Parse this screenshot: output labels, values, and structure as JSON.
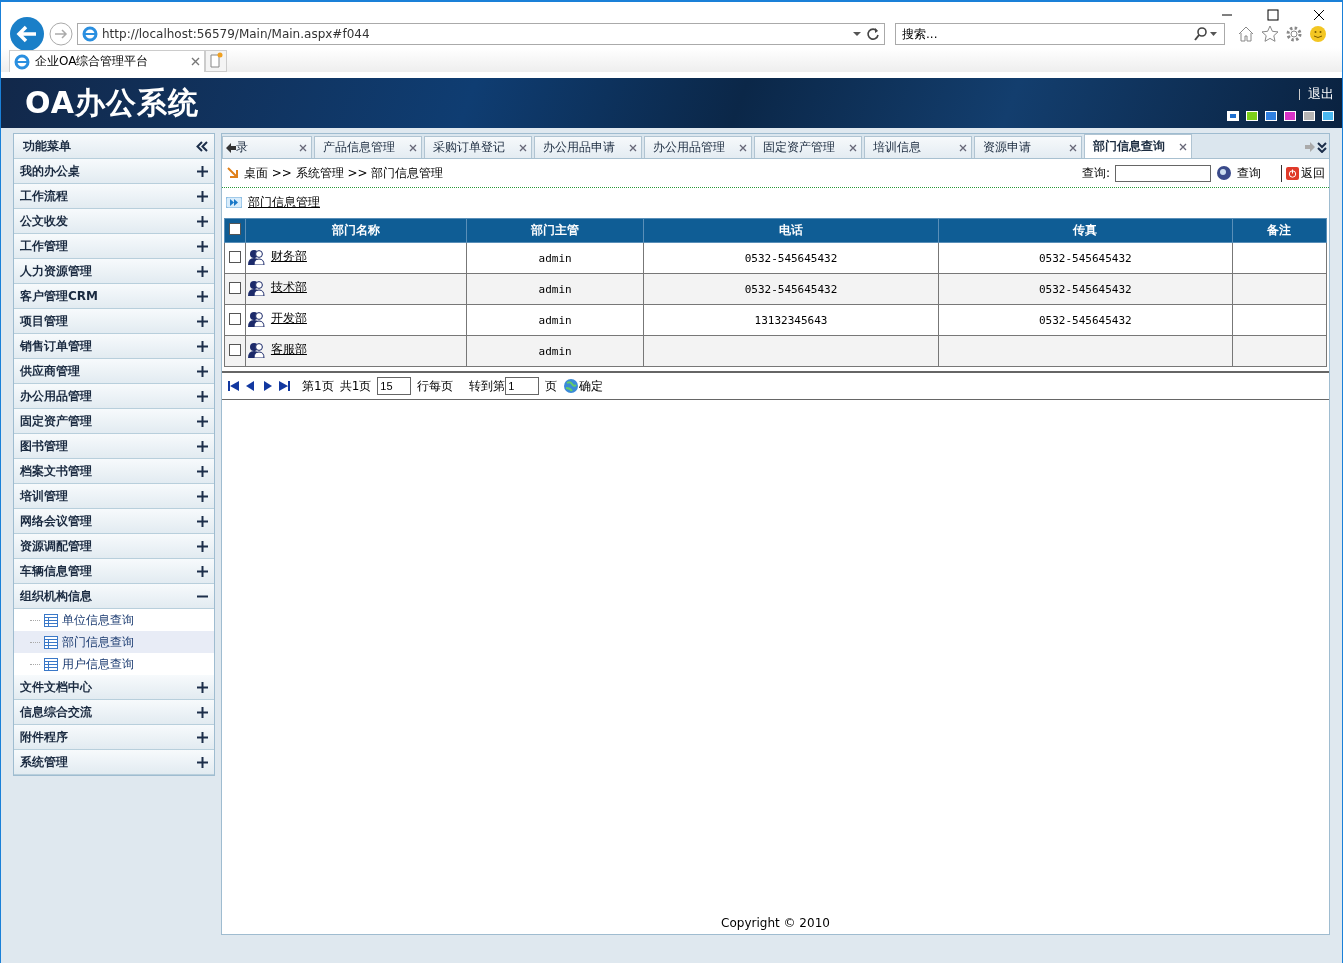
{
  "browser": {
    "address": "http://localhost:56579/Main/Main.aspx#f044",
    "search_placeholder": "搜索...",
    "tab_title": "企业OA综合管理平台"
  },
  "header": {
    "logo": "OA办公系统",
    "logout": "退出",
    "skins": [
      {
        "color": "#1e6fd0",
        "selected": true
      },
      {
        "color": "#7ccf1a",
        "selected": false
      },
      {
        "color": "#2f7fe0",
        "selected": false
      },
      {
        "color": "#d933c8",
        "selected": false
      },
      {
        "color": "#b4b4b4",
        "selected": false
      },
      {
        "color": "#49b8f0",
        "selected": false
      }
    ]
  },
  "sidebar": {
    "title": "功能菜单",
    "items": [
      {
        "label": "我的办公桌",
        "expanded": false
      },
      {
        "label": "工作流程",
        "expanded": false
      },
      {
        "label": "公文收发",
        "expanded": false
      },
      {
        "label": "工作管理",
        "expanded": false
      },
      {
        "label": "人力资源管理",
        "expanded": false
      },
      {
        "label": "客户管理CRM",
        "expanded": false
      },
      {
        "label": "项目管理",
        "expanded": false
      },
      {
        "label": "销售订单管理",
        "expanded": false
      },
      {
        "label": "供应商管理",
        "expanded": false
      },
      {
        "label": "办公用品管理",
        "expanded": false
      },
      {
        "label": "固定资产管理",
        "expanded": false
      },
      {
        "label": "图书管理",
        "expanded": false
      },
      {
        "label": "档案文书管理",
        "expanded": false
      },
      {
        "label": "培训管理",
        "expanded": false
      },
      {
        "label": "网络会议管理",
        "expanded": false
      },
      {
        "label": "资源调配管理",
        "expanded": false
      },
      {
        "label": "车辆信息管理",
        "expanded": false
      },
      {
        "label": "组织机构信息",
        "expanded": true,
        "children": [
          {
            "label": "单位信息查询",
            "selected": false
          },
          {
            "label": "部门信息查询",
            "selected": true
          },
          {
            "label": "用户信息查询",
            "selected": false
          }
        ]
      },
      {
        "label": "文件文档中心",
        "expanded": false
      },
      {
        "label": "信息综合交流",
        "expanded": false
      },
      {
        "label": "附件程序",
        "expanded": false
      },
      {
        "label": "系统管理",
        "expanded": false
      }
    ]
  },
  "tabs": [
    {
      "label": "录",
      "selected": false
    },
    {
      "label": "产品信息管理",
      "selected": false
    },
    {
      "label": "采购订单登记",
      "selected": false
    },
    {
      "label": "办公用品申请",
      "selected": false
    },
    {
      "label": "办公用品管理",
      "selected": false
    },
    {
      "label": "固定资产管理",
      "selected": false
    },
    {
      "label": "培训信息",
      "selected": false
    },
    {
      "label": "资源申请",
      "selected": false
    },
    {
      "label": "部门信息查询",
      "selected": true
    }
  ],
  "breadcrumb": "桌面 >> 系统管理 >> 部门信息管理",
  "query": {
    "label": "查询:",
    "button": "查询",
    "back": "返回"
  },
  "section_title": "部门信息管理",
  "table": {
    "columns": [
      "部门名称",
      "部门主管",
      "电话",
      "传真",
      "备注"
    ],
    "header_checked": false,
    "rows": [
      {
        "checked": false,
        "cells": [
          "财务部",
          "admin",
          "0532-545645432",
          "0532-545645432"
        ]
      },
      {
        "checked": false,
        "cells": [
          "技术部",
          "admin",
          "0532-545645432",
          "0532-545645432"
        ]
      },
      {
        "checked": false,
        "cells": [
          "开发部",
          "admin",
          "13132345643",
          "0532-545645432"
        ]
      },
      {
        "checked": false,
        "cells": [
          "客服部",
          "admin"
        ]
      }
    ]
  },
  "pager": {
    "page": "第1页",
    "total": "共1页",
    "page_size": "15",
    "per_page": "行每页",
    "goto": "转到第",
    "goto_value": "1",
    "page_unit": "页",
    "confirm": "确定"
  },
  "footer": "Copyright © 2010"
}
